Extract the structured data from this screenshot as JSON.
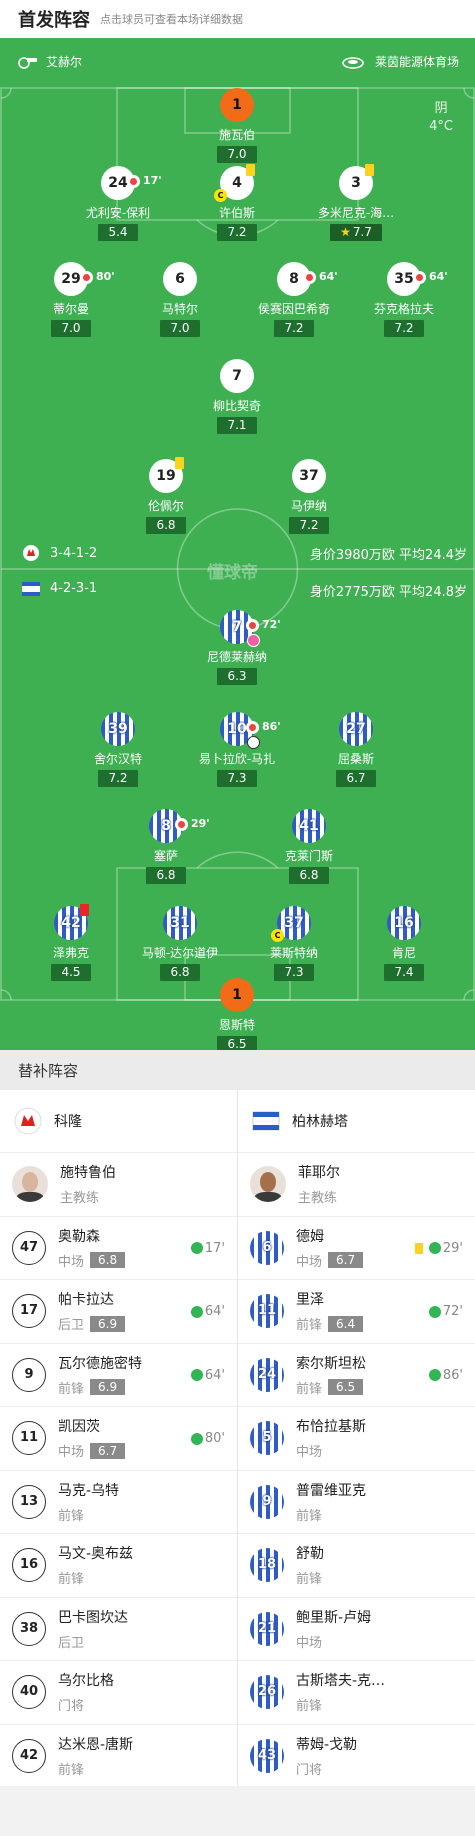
{
  "header": {
    "title": "首发阵容",
    "subtitle": "点击球员可查看本场详细数据"
  },
  "pitch": {
    "home_team": "艾赫尔",
    "venue": "莱茵能源体育场",
    "weather": "阴",
    "temperature": "4°C",
    "watermark": "懂球帝",
    "home_formation": "3-4-1-2",
    "home_value": "身价3980万欧 平均24.4岁",
    "away_formation": "4-2-3-1",
    "away_value": "身价2775万欧 平均24.8岁"
  },
  "home_players": [
    {
      "num": "1",
      "name": "施瓦伯",
      "rating": "7.0"
    },
    {
      "num": "24",
      "name": "尤利安-保利",
      "rating": "5.4",
      "sub": "17'"
    },
    {
      "num": "4",
      "name": "许伯斯",
      "rating": "7.2"
    },
    {
      "num": "3",
      "name": "多米尼克-海…",
      "rating": "7.7"
    },
    {
      "num": "29",
      "name": "蒂尔曼",
      "rating": "7.0",
      "sub": "80'"
    },
    {
      "num": "6",
      "name": "马特尔",
      "rating": "7.0"
    },
    {
      "num": "8",
      "name": "侯赛因巴希奇",
      "rating": "7.2",
      "sub": "64'"
    },
    {
      "num": "35",
      "name": "芬克格拉夫",
      "rating": "7.2",
      "sub": "64'"
    },
    {
      "num": "7",
      "name": "柳比契奇",
      "rating": "7.1"
    },
    {
      "num": "19",
      "name": "伦佩尔",
      "rating": "6.8"
    },
    {
      "num": "37",
      "name": "马伊纳",
      "rating": "7.2"
    }
  ],
  "away_players": [
    {
      "num": "7",
      "name": "尼德莱赫纳",
      "rating": "6.3",
      "sub": "72'"
    },
    {
      "num": "39",
      "name": "舍尔汉特",
      "rating": "7.2"
    },
    {
      "num": "10",
      "name": "易卜拉欣-马扎",
      "rating": "7.3",
      "sub": "86'"
    },
    {
      "num": "27",
      "name": "屈桑斯",
      "rating": "6.7"
    },
    {
      "num": "8",
      "name": "塞萨",
      "rating": "6.8",
      "sub": "29'"
    },
    {
      "num": "41",
      "name": "克莱门斯",
      "rating": "6.8"
    },
    {
      "num": "42",
      "name": "泽弗克",
      "rating": "4.5"
    },
    {
      "num": "31",
      "name": "马顿-达尔道伊",
      "rating": "6.8"
    },
    {
      "num": "37",
      "name": "莱斯特纳",
      "rating": "7.3"
    },
    {
      "num": "16",
      "name": "肯尼",
      "rating": "7.4"
    },
    {
      "num": "1",
      "name": "恩斯特",
      "rating": "6.5"
    }
  ],
  "subs": {
    "title": "替补阵容",
    "home": {
      "team": "科隆",
      "coach": {
        "name": "施特鲁伯",
        "role": "主教练"
      },
      "players": [
        {
          "num": "47",
          "name": "奥勒森",
          "pos": "中场",
          "rating": "6.8",
          "on": "17'"
        },
        {
          "num": "17",
          "name": "帕卡拉达",
          "pos": "后卫",
          "rating": "6.9",
          "on": "64'"
        },
        {
          "num": "9",
          "name": "瓦尔德施密特",
          "pos": "前锋",
          "rating": "6.9",
          "on": "64'"
        },
        {
          "num": "11",
          "name": "凯因茨",
          "pos": "中场",
          "rating": "6.7",
          "on": "80'"
        },
        {
          "num": "13",
          "name": "马克-乌特",
          "pos": "前锋"
        },
        {
          "num": "16",
          "name": "马文-奥布兹",
          "pos": "前锋"
        },
        {
          "num": "38",
          "name": "巴卡图坎达",
          "pos": "后卫"
        },
        {
          "num": "40",
          "name": "乌尔比格",
          "pos": "门将"
        },
        {
          "num": "42",
          "name": "达米恩-唐斯",
          "pos": "前锋"
        }
      ]
    },
    "away": {
      "team": "柏林赫塔",
      "coach": {
        "name": "菲耶尔",
        "role": "主教练"
      },
      "players": [
        {
          "num": "6",
          "name": "德姆",
          "pos": "中场",
          "rating": "6.7",
          "on": "29'"
        },
        {
          "num": "11",
          "name": "里泽",
          "pos": "前锋",
          "rating": "6.4",
          "on": "72'"
        },
        {
          "num": "24",
          "name": "索尔斯坦松",
          "pos": "前锋",
          "rating": "6.5",
          "on": "86'"
        },
        {
          "num": "5",
          "name": "布恰拉基斯",
          "pos": "中场"
        },
        {
          "num": "9",
          "name": "普雷维亚克",
          "pos": "前锋"
        },
        {
          "num": "18",
          "name": "舒勒",
          "pos": "前锋"
        },
        {
          "num": "21",
          "name": "鲍里斯-卢姆",
          "pos": "中场"
        },
        {
          "num": "26",
          "name": "古斯塔夫-克…",
          "pos": "前锋"
        },
        {
          "num": "43",
          "name": "蒂姆-戈勒",
          "pos": "门将"
        }
      ]
    }
  },
  "colors": {
    "pitch": "#3fb052",
    "home_gk": "#f26b16",
    "away_blue": "#2f5cc4",
    "sub_on": "#33b555"
  }
}
